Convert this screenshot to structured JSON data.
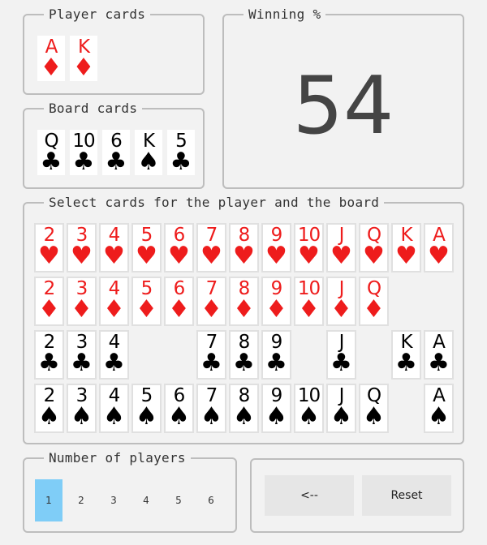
{
  "player_cards": {
    "legend": "Player cards",
    "cards": [
      {
        "rank": "A",
        "suit": "♦",
        "color": "red"
      },
      {
        "rank": "K",
        "suit": "♦",
        "color": "red"
      }
    ]
  },
  "board_cards": {
    "legend": "Board cards",
    "cards": [
      {
        "rank": "Q",
        "suit": "♣",
        "color": "black"
      },
      {
        "rank": "10",
        "suit": "♣",
        "color": "black"
      },
      {
        "rank": "6",
        "suit": "♣",
        "color": "black"
      },
      {
        "rank": "K",
        "suit": "♠",
        "color": "black"
      },
      {
        "rank": "5",
        "suit": "♣",
        "color": "black"
      }
    ]
  },
  "winning": {
    "legend": "Winning %",
    "value": "54"
  },
  "selector": {
    "legend": "Select cards for the player and the board",
    "ranks": [
      "2",
      "3",
      "4",
      "5",
      "6",
      "7",
      "8",
      "9",
      "10",
      "J",
      "Q",
      "K",
      "A"
    ],
    "rows": [
      {
        "suit": "♥",
        "color": "red",
        "name": "hearts",
        "available": [
          "2",
          "3",
          "4",
          "5",
          "6",
          "7",
          "8",
          "9",
          "10",
          "J",
          "Q",
          "K",
          "A"
        ]
      },
      {
        "suit": "♦",
        "color": "red",
        "name": "diamonds",
        "available": [
          "2",
          "3",
          "4",
          "5",
          "6",
          "7",
          "8",
          "9",
          "10",
          "J",
          "Q"
        ]
      },
      {
        "suit": "♣",
        "color": "black",
        "name": "clubs",
        "available": [
          "2",
          "3",
          "4",
          "7",
          "8",
          "9",
          "J",
          "K",
          "A"
        ]
      },
      {
        "suit": "♠",
        "color": "black",
        "name": "spades",
        "available": [
          "2",
          "3",
          "4",
          "5",
          "6",
          "7",
          "8",
          "9",
          "10",
          "J",
          "Q",
          "A"
        ]
      }
    ]
  },
  "players": {
    "legend": "Number of players",
    "options": [
      "1",
      "2",
      "3",
      "4",
      "5",
      "6"
    ],
    "selected": "1",
    "selected_color": "#7fcdf7"
  },
  "actions": {
    "back_label": "<--",
    "reset_label": "Reset"
  }
}
